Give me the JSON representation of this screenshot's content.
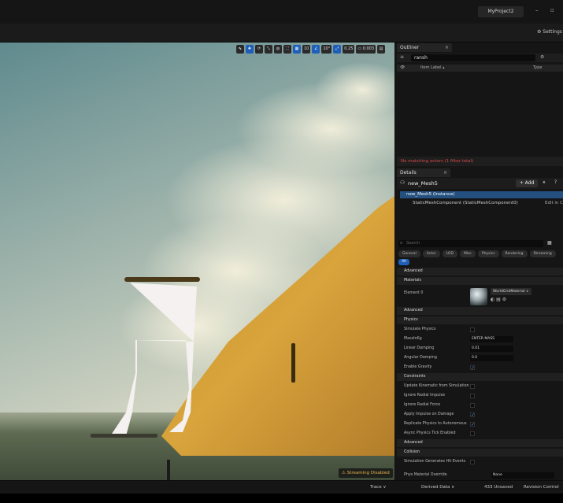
{
  "window": {
    "project_name": "MyProject2",
    "minimize": "–",
    "maximize": "▫"
  },
  "toolbar": {
    "settings": "Settings"
  },
  "viewport": {
    "toolbar": [
      {
        "label": "⬉",
        "active": false
      },
      {
        "label": "✥",
        "active": true
      },
      {
        "label": "⟳",
        "active": false
      },
      {
        "label": "⤡",
        "active": false
      },
      {
        "label": "◍",
        "active": false
      },
      {
        "label": "⛶",
        "active": false
      },
      {
        "label": "▦",
        "active": true
      },
      {
        "label": "10",
        "active": false
      },
      {
        "label": "∠",
        "active": true
      },
      {
        "label": "10°",
        "active": false
      },
      {
        "label": "⤢",
        "active": true
      },
      {
        "label": "0.25",
        "active": false
      },
      {
        "label": "▭ 0.003",
        "active": false
      },
      {
        "label": "▤",
        "active": false
      }
    ],
    "streaming_badge": "⚠ Streaming Disabled",
    "colors": {
      "sky_top": "#5f8a8e",
      "sky_bottom": "#d4d6c4",
      "cliff": "#d9a43c",
      "sea": "#5f6a52"
    }
  },
  "outliner": {
    "tab": "Outliner",
    "search_value": "ransh",
    "col_label": "Item Label ▴",
    "col_type": "Type",
    "empty_message": "No matching actors (1 filter total)"
  },
  "details": {
    "tab": "Details",
    "actor_name": "new_Mesh5",
    "add_label": "+ Add",
    "components": {
      "instance": "new_Mesh5 (Instance)",
      "mesh": "StaticMeshComponent (StaticMeshComponent0)",
      "edit": "Edit in C"
    },
    "search_placeholder": "Search",
    "filters": [
      "General",
      "Actor",
      "LOD",
      "Misc",
      "Physics",
      "Rendering",
      "Streaming"
    ],
    "filter_all": "All",
    "sections": {
      "advanced1": "Advanced",
      "materials": "Materials",
      "advanced2": "Advanced",
      "physics": "Physics",
      "constraints": "Constraints",
      "advanced3": "Advanced",
      "collision": "Collision"
    },
    "material": {
      "element_label": "Element 0",
      "value": "WorldGridMaterial"
    },
    "physics_rows": [
      {
        "label": "Simulate Physics",
        "type": "check",
        "on": false
      },
      {
        "label": "MassInKg",
        "type": "value",
        "value": "ENTER MASS"
      },
      {
        "label": "Linear Damping",
        "type": "value",
        "value": "0.01"
      },
      {
        "label": "Angular Damping",
        "type": "value",
        "value": "0.0"
      },
      {
        "label": "Enable Gravity",
        "type": "check",
        "on": true
      }
    ],
    "constraint_rows": [
      {
        "label": "Update Kinematic from Simulation",
        "type": "check",
        "on": false
      },
      {
        "label": "Ignore Radial Impulse",
        "type": "check",
        "on": false
      },
      {
        "label": "Ignore Radial Force",
        "type": "check",
        "on": false
      },
      {
        "label": "Apply Impulse on Damage",
        "type": "check",
        "on": true
      },
      {
        "label": "Replicate Physics to Autonomous",
        "type": "check",
        "on": true
      },
      {
        "label": "Async Physics Tick Enabled",
        "type": "check",
        "on": false
      }
    ],
    "collision_rows": [
      {
        "label": "Simulation Generates Hit Events"
      },
      {
        "label": "Phys Material Override",
        "value": "None"
      }
    ]
  },
  "statusbar": {
    "trace": "Trace ∨",
    "derived": "Derived Data ∨",
    "unsaved": "433 Unsaved",
    "revision": "Revision Control"
  }
}
